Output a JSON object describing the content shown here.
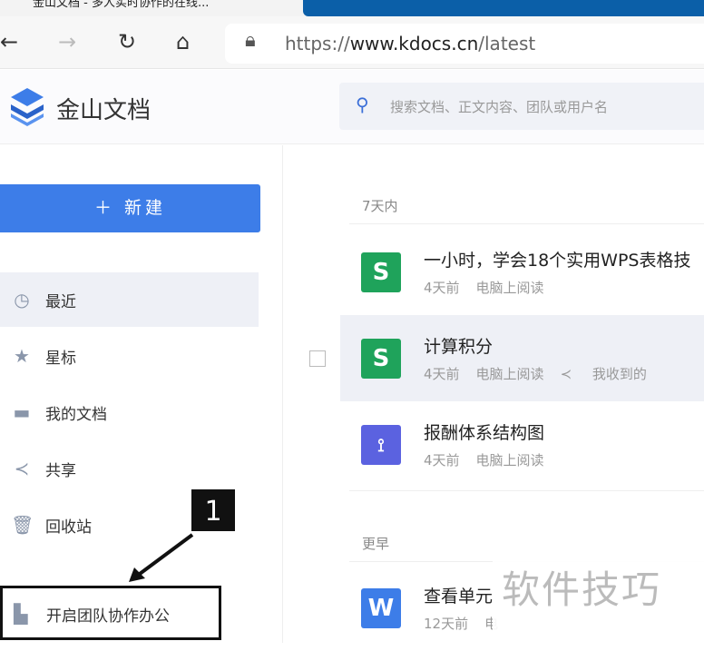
{
  "browser": {
    "tab_title": "金山文档 - 多人实时协作的在线...",
    "url_prefix": "https://",
    "url_domain": "www.kdocs.cn",
    "url_path": "/latest"
  },
  "app": {
    "brand": "金山文档",
    "search_placeholder": "搜索文档、正文内容、团队或用户名"
  },
  "sidebar": {
    "new_label": "新建",
    "items": [
      {
        "label": "最近",
        "icon": "clock-icon"
      },
      {
        "label": "星标",
        "icon": "star-icon"
      },
      {
        "label": "我的文档",
        "icon": "folder-icon"
      },
      {
        "label": "共享",
        "icon": "share-icon"
      },
      {
        "label": "回收站",
        "icon": "trash-icon"
      }
    ],
    "team_label": "开启团队协作办公"
  },
  "annotation": {
    "marker": "1"
  },
  "main": {
    "sections": [
      {
        "label": "7天内"
      },
      {
        "label": "更早"
      }
    ],
    "files": [
      {
        "title": "一小时，学会18个实用WPS表格技",
        "time": "4天前",
        "source": "电脑上阅读",
        "type": "S",
        "color": "#1fa35b"
      },
      {
        "title": "计算积分",
        "time": "4天前",
        "source": "电脑上阅读",
        "shared": "我收到的",
        "type": "S",
        "color": "#1fa35b"
      },
      {
        "title": "报酬体系结构图",
        "time": "4天前",
        "source": "电脑上阅读",
        "type": "flow",
        "color": "#5b62e0"
      },
      {
        "title": "查看单元",
        "time": "12天前",
        "source": "电",
        "type": "W",
        "color": "#3d7de8"
      }
    ]
  },
  "watermark": "软件技巧"
}
